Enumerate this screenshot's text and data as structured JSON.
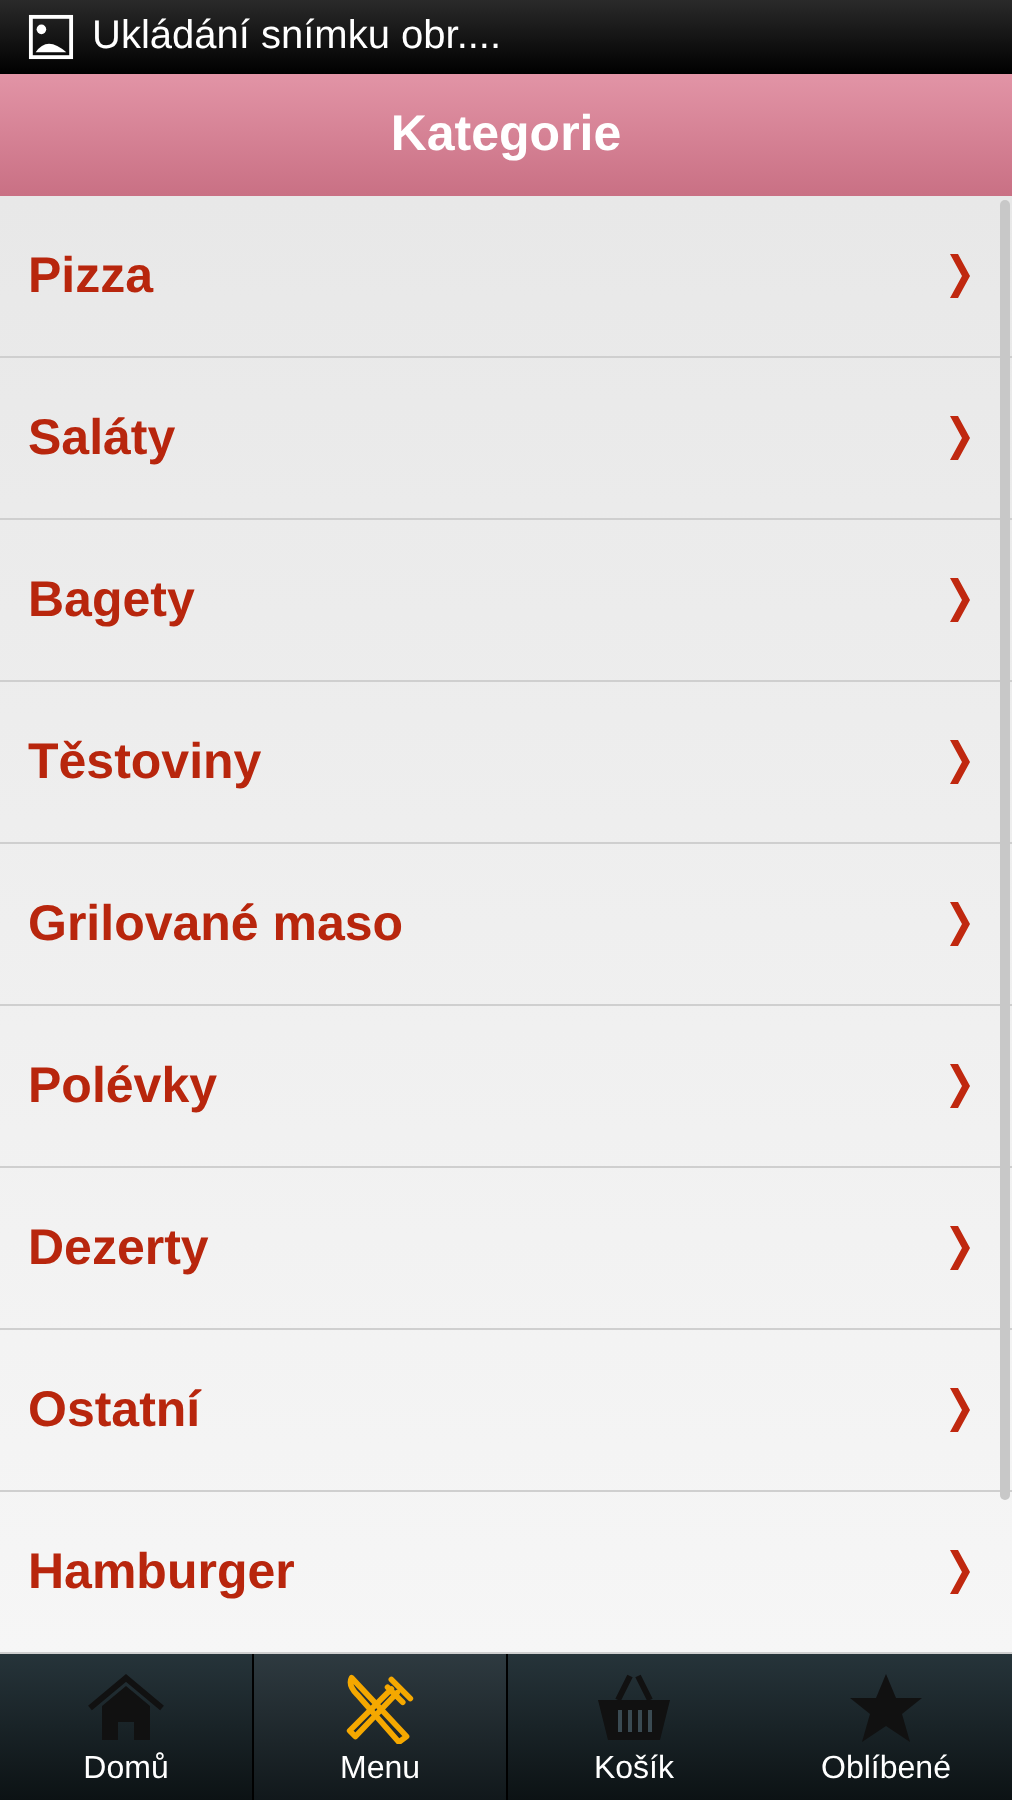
{
  "status_bar": {
    "notification": "Ukládání snímku obr...."
  },
  "header": {
    "title": "Kategorie"
  },
  "categories": [
    {
      "label": "Pizza"
    },
    {
      "label": "Saláty"
    },
    {
      "label": "Bagety"
    },
    {
      "label": "Těstoviny"
    },
    {
      "label": "Grilované maso"
    },
    {
      "label": "Polévky"
    },
    {
      "label": "Dezerty"
    },
    {
      "label": "Ostatní"
    },
    {
      "label": "Hamburger"
    }
  ],
  "tabs": [
    {
      "label": "Domů",
      "kind": "home",
      "selected": false
    },
    {
      "label": "Menu",
      "kind": "menu",
      "selected": true
    },
    {
      "label": "Košík",
      "kind": "basket",
      "selected": false
    },
    {
      "label": "Oblíbené",
      "kind": "star",
      "selected": false
    }
  ]
}
